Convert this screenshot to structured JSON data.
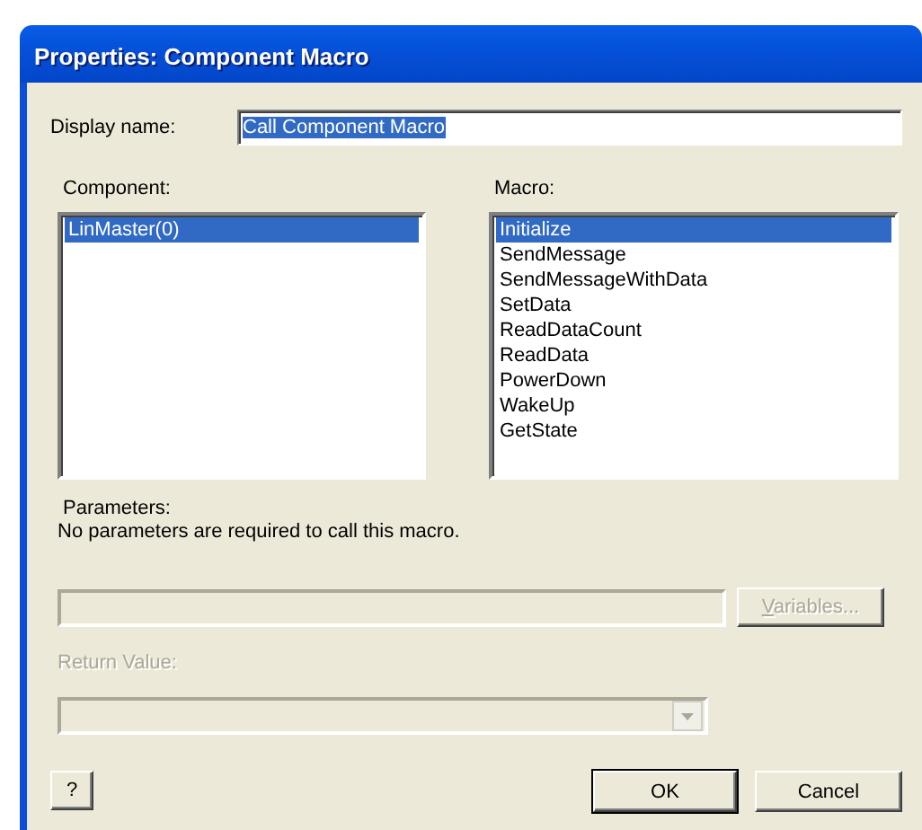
{
  "window": {
    "title": "Properties: Component Macro"
  },
  "display_name": {
    "label": "Display name:",
    "value": "Call Component Macro",
    "text_selected": true
  },
  "component": {
    "label": "Component:",
    "items": [
      {
        "text": "LinMaster(0)",
        "selected": true
      }
    ]
  },
  "macro": {
    "label": "Macro:",
    "items": [
      {
        "text": "Initialize",
        "selected": true
      },
      {
        "text": "SendMessage",
        "selected": false
      },
      {
        "text": "SendMessageWithData",
        "selected": false
      },
      {
        "text": "SetData",
        "selected": false
      },
      {
        "text": "ReadDataCount",
        "selected": false
      },
      {
        "text": "ReadData",
        "selected": false
      },
      {
        "text": "PowerDown",
        "selected": false
      },
      {
        "text": "WakeUp",
        "selected": false
      },
      {
        "text": "GetState",
        "selected": false
      }
    ]
  },
  "parameters": {
    "label": "Parameters:",
    "description": "No parameters are required to call this macro."
  },
  "parameter_field": {
    "disabled": true
  },
  "variables_button": {
    "label": "Variables...",
    "disabled": true
  },
  "return_value": {
    "label": "Return Value:",
    "disabled": true
  },
  "buttons": [
    {
      "kind": "help",
      "label": "?",
      "default": false
    },
    {
      "kind": "ok",
      "label": "OK",
      "default": true
    },
    {
      "kind": "cancel",
      "label": "Cancel",
      "default": false
    }
  ]
}
